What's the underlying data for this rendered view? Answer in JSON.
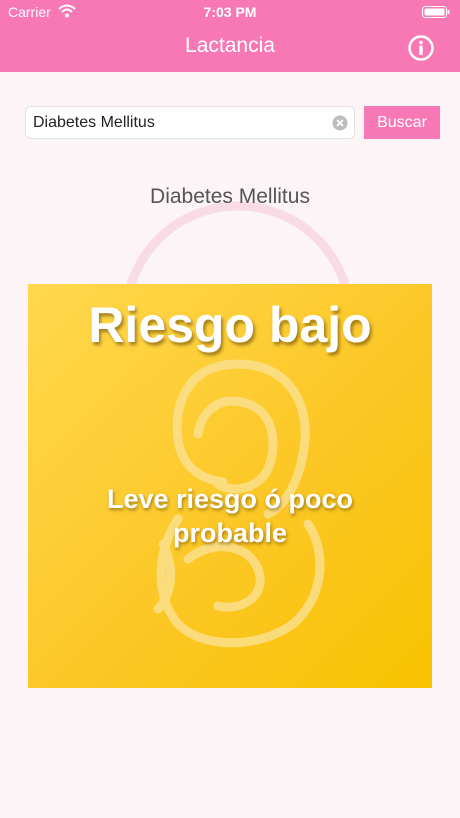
{
  "status_bar": {
    "carrier": "Carrier",
    "time": "7:03 PM",
    "wifi_icon": "wifi-icon",
    "battery_icon": "battery-icon"
  },
  "nav": {
    "title": "Lactancia",
    "info_icon": "info-icon"
  },
  "search": {
    "value": "Diabetes Mellitus",
    "placeholder": "",
    "clear_icon": "clear-icon",
    "button_label": "Buscar"
  },
  "result": {
    "query_title": "Diabetes Mellitus",
    "risk_level": "Riesgo bajo",
    "risk_description": "Leve riesgo ó poco probable",
    "card_color": "#fbc622",
    "illustration_icon": "mother-breastfeeding-icon"
  },
  "colors": {
    "accent": "#f878b6",
    "background": "#fdf4f8"
  }
}
